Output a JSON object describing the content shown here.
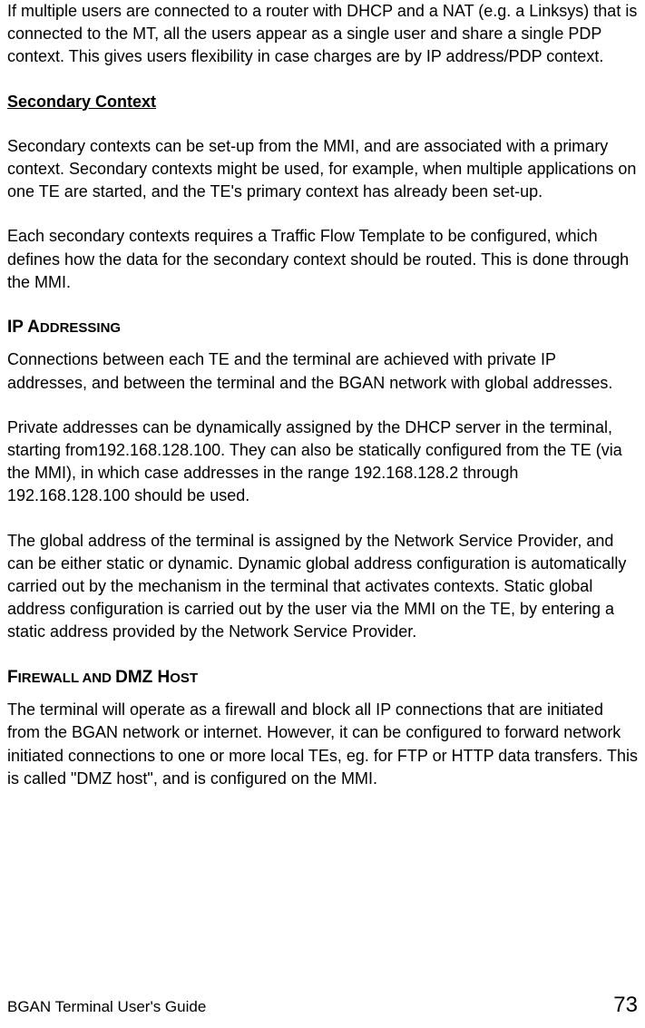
{
  "para1": "If multiple users are connected to a router with DHCP and a NAT (e.g. a Linksys) that is connected to the MT, all the users appear as a single user and share a single PDP context. This gives users flexibility in case charges are by IP address/PDP context.",
  "heading_secondary": "Secondary Context",
  "para2": "Secondary contexts can be set-up from the MMI, and are associated with a primary context. Secondary contexts might be used, for example, when multiple applications on one TE are started, and the TE's primary context has already been set-up.",
  "para3": "Each secondary contexts requires a Traffic Flow Template to be configured, which defines how the data for the secondary context should be routed. This is done through the MMI.",
  "heading_ip_first": "IP A",
  "heading_ip_rest": "DDRESSING",
  "para4": "Connections between each TE and the terminal are achieved with private IP addresses, and between the terminal and the BGAN network with global addresses.",
  "para5": "Private addresses can be dynamically assigned by the DHCP server in the terminal, starting from192.168.128.100. They can also be statically configured from the TE (via the MMI), in which case addresses in the range 192.168.128.2 through 192.168.128.100 should be used.",
  "para6": "The global address of the terminal is assigned by the Network Service Provider, and can be either static or dynamic.  Dynamic global address configuration is automatically carried out by the mechanism in the terminal that activates contexts. Static global address configuration is carried out by the user via the MMI on the TE, by entering a static address provided by the Network Service Provider.",
  "heading_firewall_p1a": "F",
  "heading_firewall_p1b": "IREWALL AND ",
  "heading_firewall_p2a": "DMZ H",
  "heading_firewall_p2b": "OST",
  "para7": "The terminal will operate as a firewall and block all IP connections that are initiated from the BGAN network or internet. However, it can be configured to forward network initiated connections to one or more local TEs, eg. for FTP or HTTP data transfers. This is called \"DMZ host\", and is configured on the MMI.",
  "footer_title": "BGAN Terminal User's Guide",
  "page_number": "73"
}
